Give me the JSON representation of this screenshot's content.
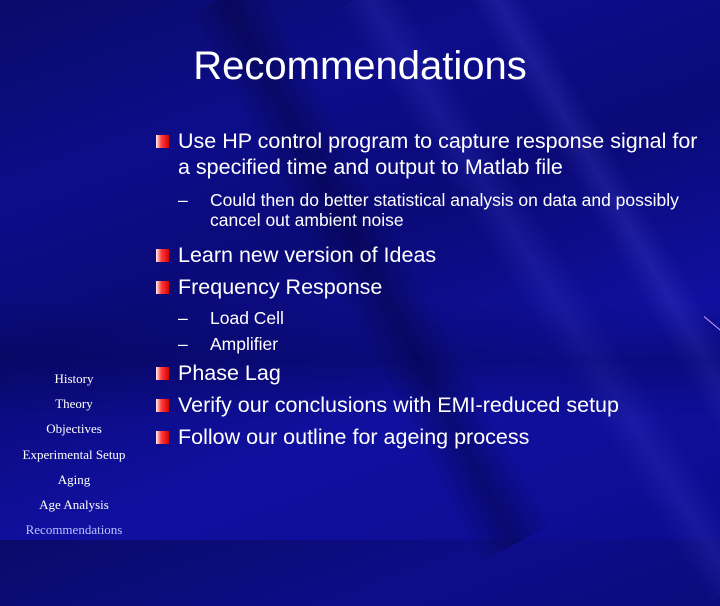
{
  "slide": {
    "title": "Recommendations",
    "bullets": [
      {
        "text": "Use HP control program to capture response signal for a specified time and output to Matlab file",
        "sub": [
          "Could then do better statistical analysis on data and possibly cancel out ambient noise"
        ]
      },
      {
        "text": "Learn new version of Ideas",
        "sub": []
      },
      {
        "text": "Frequency Response",
        "sub": [
          "Load Cell",
          "Amplifier"
        ]
      },
      {
        "text": "Phase Lag",
        "sub": []
      },
      {
        "text": "Verify our conclusions with EMI-reduced setup",
        "sub": []
      },
      {
        "text": "Follow our outline for ageing process",
        "sub": []
      }
    ],
    "dash": "–"
  },
  "nav": {
    "items": [
      "History",
      "Theory",
      "Objectives",
      "Experimental Setup",
      "Aging",
      "Age Analysis",
      "Recommendations"
    ],
    "active": "Recommendations"
  },
  "colors": {
    "bullet": "#e00000",
    "background": "#0d0d8a",
    "nav_active": "#b8c0ff"
  }
}
